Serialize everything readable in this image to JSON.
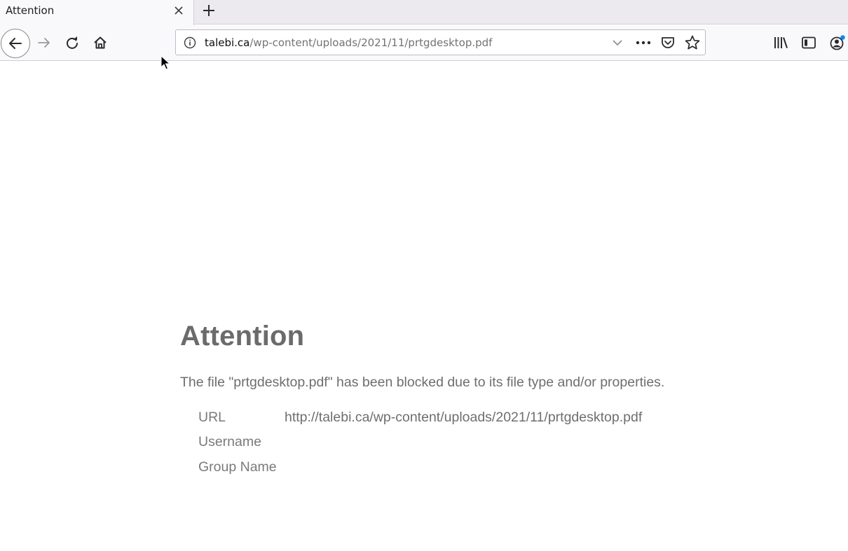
{
  "browser": {
    "tab": {
      "title": "Attention"
    },
    "urlbar": {
      "host": "talebi.ca",
      "path": "/wp-content/uploads/2021/11/prtgdesktop.pdf"
    },
    "icons": {
      "close": "close-icon",
      "new_tab": "plus-icon",
      "back": "back-arrow-icon",
      "forward": "forward-arrow-icon",
      "reload": "reload-icon",
      "home": "home-icon",
      "info": "info-icon",
      "dropdown": "chevron-down-icon",
      "page_actions": "ellipsis-icon",
      "pocket": "pocket-icon",
      "bookmark": "star-icon",
      "library": "library-icon",
      "sidebar": "sidebar-icon",
      "account": "account-icon"
    },
    "accent_color": "#0a84ff"
  },
  "page": {
    "heading": "Attention",
    "message": "The file \"prtgdesktop.pdf\" has been blocked due to its file type and/or properties.",
    "details": [
      {
        "label": "URL",
        "value": "http://talebi.ca/wp-content/uploads/2021/11/prtgdesktop.pdf"
      },
      {
        "label": "Username",
        "value": ""
      },
      {
        "label": "Group Name",
        "value": ""
      }
    ]
  }
}
